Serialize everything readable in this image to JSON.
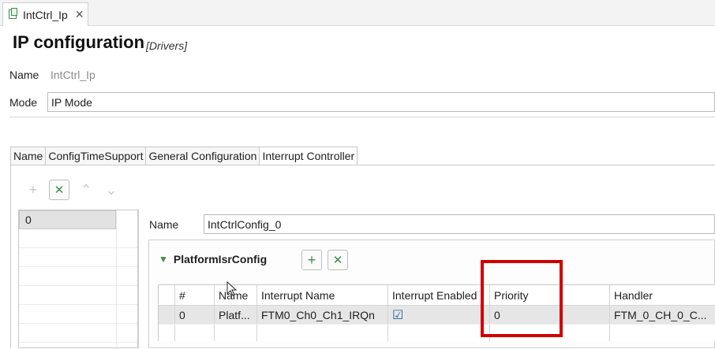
{
  "editor_tab": {
    "label": "IntCtrl_Ip",
    "close": "✕"
  },
  "header": {
    "title": "IP configuration",
    "tag": "[Drivers]"
  },
  "fields": {
    "name_label": "Name",
    "name_value": "IntCtrl_Ip",
    "mode_label": "Mode",
    "mode_value": "IP Mode"
  },
  "section_tabs": [
    "Name",
    "ConfigTimeSupport",
    "General Configuration",
    "Interrupt Controller"
  ],
  "active_tab": "Interrupt Controller",
  "list_toolbar": {
    "add": "+",
    "remove": "✕",
    "up": "⌃",
    "down": "⌄"
  },
  "list": {
    "items": [
      "0"
    ]
  },
  "detail": {
    "name_label": "Name",
    "name_value": "IntCtrlConfig_0",
    "group_title": "PlatformIsrConfig",
    "group_add": "+",
    "group_remove": "✕"
  },
  "table": {
    "headers": [
      "#",
      "Name",
      "Interrupt Name",
      "Interrupt Enabled",
      "Priority",
      "Handler"
    ],
    "rows": [
      {
        "index": "0",
        "name": "Platf...",
        "interrupt_name": "FTM0_Ch0_Ch1_IRQn",
        "enabled": "☑",
        "priority": "0",
        "handler": "FTM_0_CH_0_C..."
      }
    ]
  },
  "colors": {
    "highlight_box": "#d00000",
    "icon_green": "#3d8a4f"
  }
}
